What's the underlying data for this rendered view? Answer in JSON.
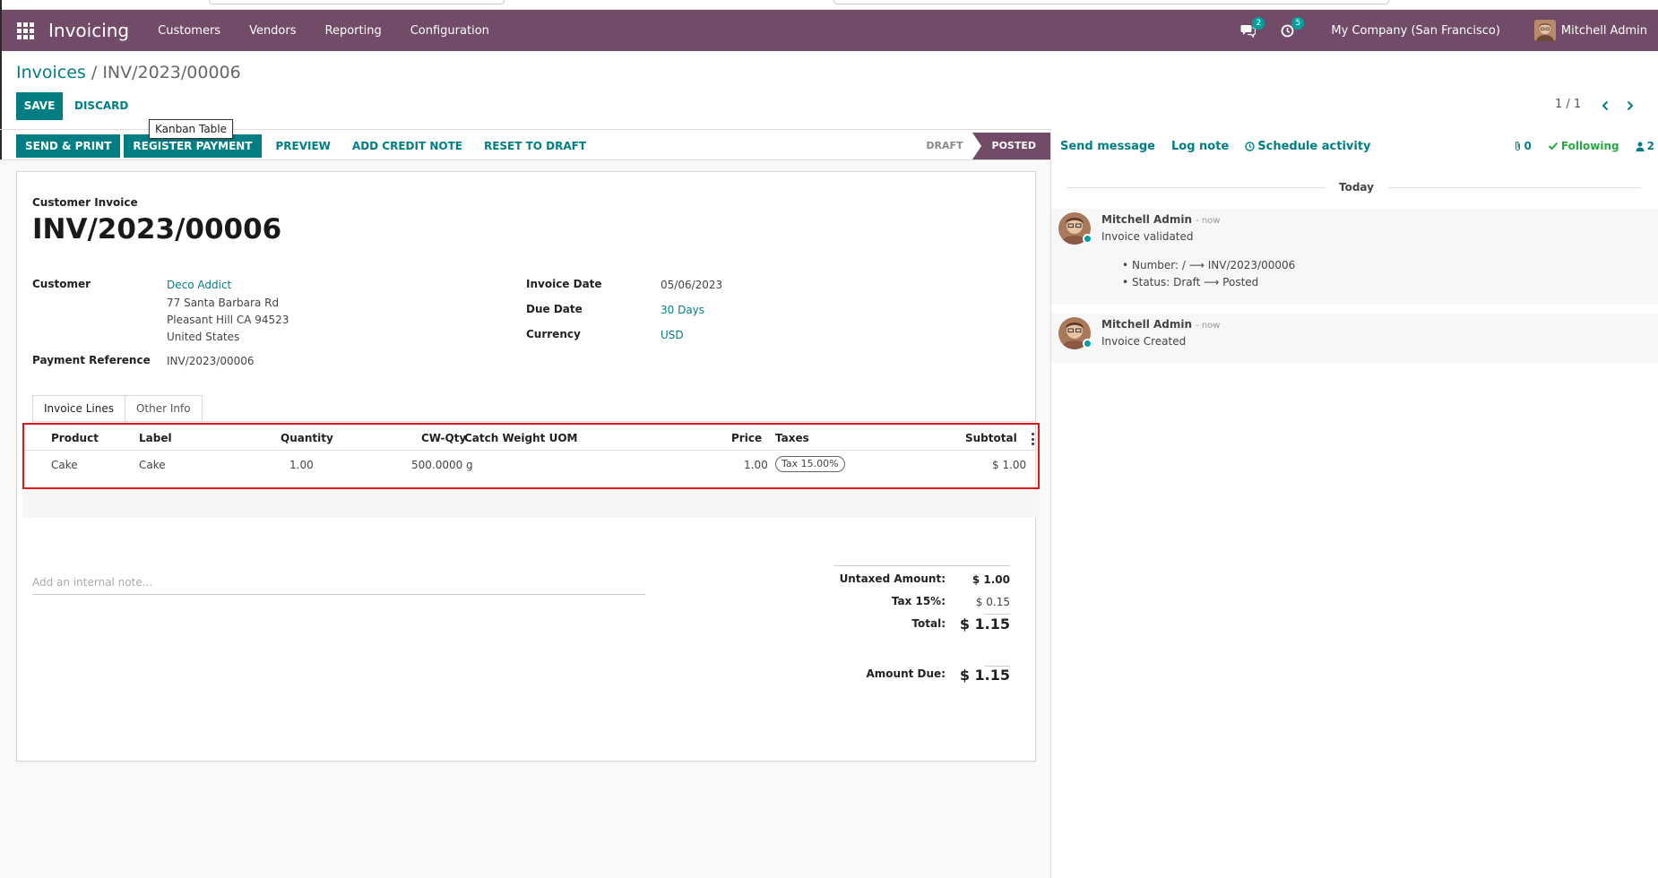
{
  "navbar": {
    "app_name": "Invoicing",
    "menu": [
      "Customers",
      "Vendors",
      "Reporting",
      "Configuration"
    ],
    "messages_count": "2",
    "activities_count": "5",
    "company": "My Company (San Francisco)",
    "user": "Mitchell Admin"
  },
  "breadcrumb": {
    "parent": "Invoices",
    "separator": " / ",
    "current": "INV/2023/00006"
  },
  "controls": {
    "save_label": "SAVE",
    "discard_label": "DISCARD",
    "pager": "1 / 1",
    "tooltip": "Kanban Table"
  },
  "statusbar": {
    "buttons": [
      "SEND & PRINT",
      "REGISTER PAYMENT",
      "PREVIEW",
      "ADD CREDIT NOTE",
      "RESET TO DRAFT"
    ],
    "stages": [
      "DRAFT",
      "POSTED"
    ],
    "active_stage": "POSTED"
  },
  "invoice": {
    "type_label": "Customer Invoice",
    "number": "INV/2023/00006",
    "customer_label": "Customer",
    "customer_name": "Deco Addict",
    "address_line1": "77 Santa Barbara Rd",
    "address_line2": "Pleasant Hill CA 94523",
    "address_line3": "United States",
    "payment_ref_label": "Payment Reference",
    "payment_ref": "INV/2023/00006",
    "invoice_date_label": "Invoice Date",
    "invoice_date": "05/06/2023",
    "due_date_label": "Due Date",
    "due_date": "30 Days",
    "currency_label": "Currency",
    "currency": "USD"
  },
  "tabs": [
    "Invoice Lines",
    "Other Info"
  ],
  "lines": {
    "headers": {
      "product": "Product",
      "label": "Label",
      "quantity": "Quantity",
      "cw_qty": "CW-Qty",
      "cw_uom": "Catch Weight UOM",
      "price": "Price",
      "taxes": "Taxes",
      "subtotal": "Subtotal"
    },
    "rows": [
      {
        "product": "Cake",
        "label": "Cake",
        "quantity": "1.00",
        "cw_qty": "500.0000",
        "cw_uom": "g",
        "price": "1.00",
        "tax": "Tax 15.00%",
        "subtotal": "$ 1.00"
      }
    ]
  },
  "note_placeholder": "Add an internal note...",
  "totals": {
    "untaxed_label": "Untaxed Amount:",
    "untaxed": "$ 1.00",
    "tax_label": "Tax 15%:",
    "tax": "$ 0.15",
    "total_label": "Total:",
    "total": "$ 1.15",
    "amount_due_label": "Amount Due:",
    "amount_due": "$ 1.15"
  },
  "chatter": {
    "send_message": "Send message",
    "log_note": "Log note",
    "schedule_activity": "Schedule activity",
    "attachments": "0",
    "following": "Following",
    "followers": "2",
    "date_separator": "Today",
    "messages": [
      {
        "author": "Mitchell Admin",
        "time": "- now",
        "body": "Invoice validated",
        "tracking": [
          "Number: / ⟶ INV/2023/00006",
          "Status: Draft ⟶ Posted"
        ]
      },
      {
        "author": "Mitchell Admin",
        "time": "- now",
        "body": "Invoice Created"
      }
    ]
  },
  "colors": {
    "brand": "#714b67",
    "accent": "#017e84",
    "highlight_border": "#e0161e",
    "following": "#28a745"
  }
}
